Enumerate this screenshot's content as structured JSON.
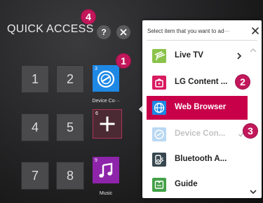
{
  "quick_access": {
    "title": "QUICK ACCESS",
    "tiles": [
      {
        "label": "1"
      },
      {
        "label": "2"
      },
      {
        "label": "4"
      },
      {
        "label": "5"
      },
      {
        "label": "7"
      },
      {
        "label": "8"
      }
    ],
    "apps": [
      {
        "slot": "3",
        "caption": "Device Co···",
        "icon": "device-connector-icon",
        "color": "#1e88e5"
      },
      {
        "slot": "6",
        "caption": "",
        "icon": "plus-icon",
        "color": "#5a2a35"
      },
      {
        "slot": "9",
        "caption": "Music",
        "icon": "music-note-icon",
        "color": "#8e24aa"
      }
    ]
  },
  "badges": {
    "b1": "1",
    "b2": "2",
    "b3": "3",
    "b4": "4"
  },
  "panel": {
    "header": "Select item that you want to ad···",
    "items": [
      {
        "label": "Live TV",
        "icon": "antenna-icon",
        "color": "#8bc34a"
      },
      {
        "label": "LG Content ...",
        "icon": "lg-content-icon",
        "color": "#d81b60"
      },
      {
        "label": "Web Browser",
        "icon": "globe-icon",
        "color": "#1e88e5",
        "state": "selected"
      },
      {
        "label": "Device Con...",
        "icon": "device-connector-icon",
        "color": "#b9d8f3",
        "state": "disabled"
      },
      {
        "label": "Bluetooth A...",
        "icon": "bluetooth-audio-icon",
        "color": "#37474f"
      },
      {
        "label": "Guide",
        "icon": "guide-icon",
        "color": "#43a047"
      }
    ]
  },
  "colors": {
    "accent": "#c8004a",
    "badge": "#c2185b",
    "tile": "#4a4a4c"
  }
}
